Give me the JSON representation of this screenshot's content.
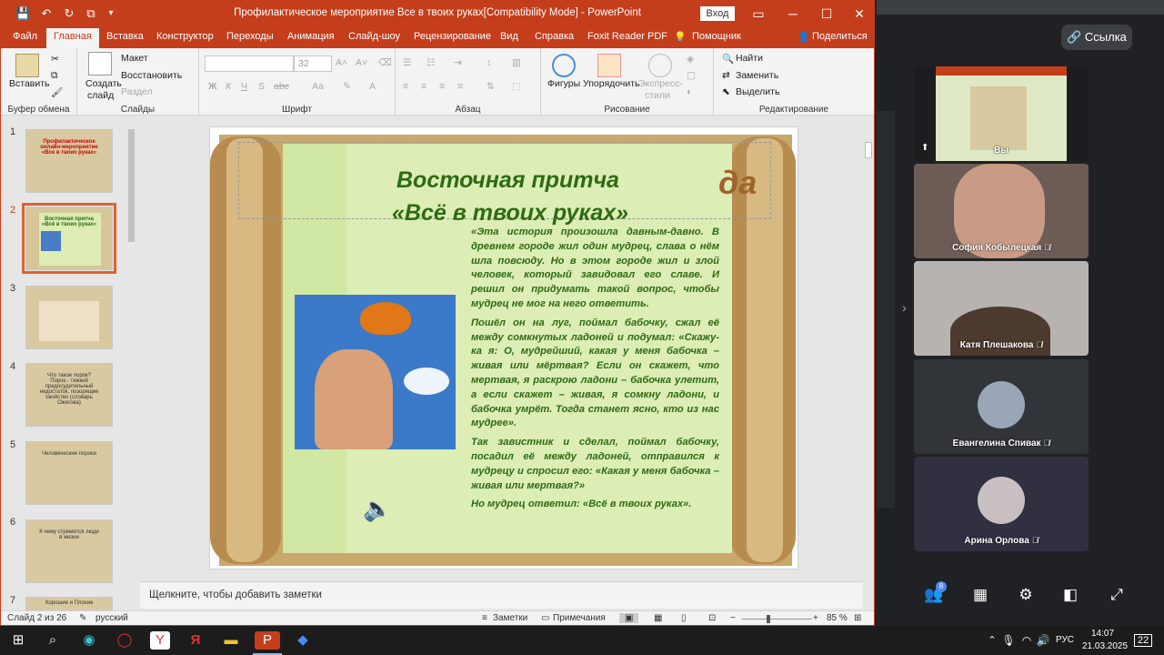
{
  "window": {
    "title": "Профилактическое мероприятие Все в твоих руках[Compatibility Mode]  -  PowerPoint",
    "signin": "Вход"
  },
  "tabs": [
    "Файл",
    "Главная",
    "Вставка",
    "Конструктор",
    "Переходы",
    "Анимация",
    "Слайд-шоу",
    "Рецензирование",
    "Вид",
    "Справка",
    "Foxit Reader PDF",
    "Помощник",
    "Поделиться"
  ],
  "ribbon": {
    "clipboard": {
      "paste": "Вставить",
      "label": "Буфер обмена"
    },
    "slides": {
      "new": "Создать",
      "new2": "слайд",
      "layout": "Макет",
      "reset": "Восстановить",
      "section": "Раздел",
      "label": "Слайды"
    },
    "font": {
      "size": "32",
      "bold": "Ж",
      "italic": "К",
      "underline": "Ч",
      "strike": "S",
      "spacing": "abc",
      "case": "Аа",
      "label": "Шрифт"
    },
    "paragraph": {
      "label": "Абзац"
    },
    "drawing": {
      "shapes": "Фигуры",
      "arrange": "Упорядочить",
      "quick": "Экспресс-",
      "quick2": "стили",
      "label": "Рисование"
    },
    "editing": {
      "find": "Найти",
      "replace": "Заменить",
      "select": "Выделить",
      "label": "Редактирование"
    }
  },
  "thumbs": [
    {
      "n": "1",
      "text": "Профилактическое онлайн-мероприятие «Все в твоих руках»"
    },
    {
      "n": "2",
      "text": "Восточная притча «Всё в твоих руках»"
    },
    {
      "n": "3",
      "text": ""
    },
    {
      "n": "4",
      "text": "Что такое порок? Порок - тяжкий предосудительный недостаток, позорящее свойство (словарь Ожегова)"
    },
    {
      "n": "5",
      "text": "Человеческие пороки"
    },
    {
      "n": "6",
      "text": "К чему стремятся люди в жизни"
    },
    {
      "n": "7",
      "text": "Хорошие и Плохие"
    }
  ],
  "slide": {
    "title1": "Восточная притча",
    "title2": "«Всё в твоих руках»",
    "ghost": "да",
    "p1": "«Эта история произошла давным-давно. В древнем городе жил один мудрец, слава о нём шла повсюду. Но в этом городе жил и злой человек, который завидовал его славе. И решил он придумать такой вопрос, чтобы мудрец не мог на него ответить.",
    "p2": "Пошёл он на луг, поймал бабочку, сжал её между сомкнутых ладоней и подумал: «Скажу-ка я: О, мудрейший, какая у меня бабочка – живая или мёртвая? Если он скажет, что мертвая, я раскрою ладони – бабочка улетит, а если скажет – живая, я сомкну ладони, и бабочка умрёт. Тогда станет ясно, кто из нас мудрее».",
    "p3": "Так завистник и сделал, поймал бабочку, посадил её между ладоней, отправился к мудрецу и спросил его: «Какая у меня бабочка – живая или мертвая?»",
    "p4": "Но мудрец ответил: «Всё в твоих руках»."
  },
  "notes": "Щелкните, чтобы добавить заметки",
  "status": {
    "slide": "Слайд 2 из 26",
    "lang": "русский",
    "notes": "Заметки",
    "comments": "Примечания",
    "zoom": "85 %"
  },
  "meet": {
    "link": "Ссылка",
    "badge": "8",
    "participants": [
      {
        "name": "Вы"
      },
      {
        "name": "София Кобылецкая"
      },
      {
        "name": "Катя Плешакова"
      },
      {
        "name": "Евангелина Спивак"
      },
      {
        "name": "Арина Орлова"
      }
    ]
  },
  "taskbar": {
    "lang": "РУС",
    "time": "14:07",
    "date": "21.03.2025",
    "notif": "22"
  },
  "colors": {
    "accent": "#c43e1c",
    "slide_text": "#2e6b14",
    "meet_bg": "#202124"
  }
}
